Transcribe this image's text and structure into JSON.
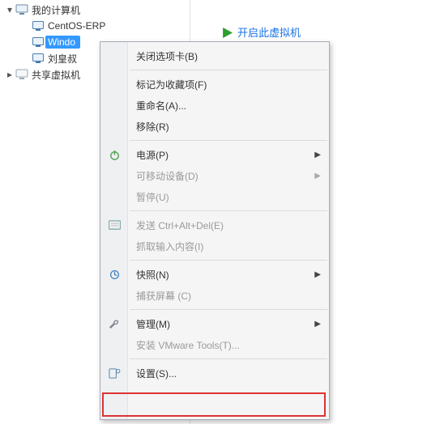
{
  "tree": {
    "root": {
      "label": "我的计算机"
    },
    "item0": {
      "label": "CentOS-ERP"
    },
    "item1": {
      "label": "Windo"
    },
    "item2": {
      "label": "刘皇叔"
    },
    "shared": {
      "label": "共享虚拟机"
    }
  },
  "action": {
    "poweron": "开启此虚拟机"
  },
  "menu": {
    "closeTab": "关闭选项卡(B)",
    "markFav": "标记为收藏项(F)",
    "rename": "重命名(A)...",
    "remove": "移除(R)",
    "power": "电源(P)",
    "removable": "可移动设备(D)",
    "pause": "暂停(U)",
    "sendCAD": "发送 Ctrl+Alt+Del(E)",
    "grabInput": "抓取输入内容(I)",
    "snapshot": "快照(N)",
    "capture": "捕获屏幕 (C)",
    "manage": "管理(M)",
    "installVT": "安装 VMware Tools(T)...",
    "settings": "设置(S)..."
  }
}
